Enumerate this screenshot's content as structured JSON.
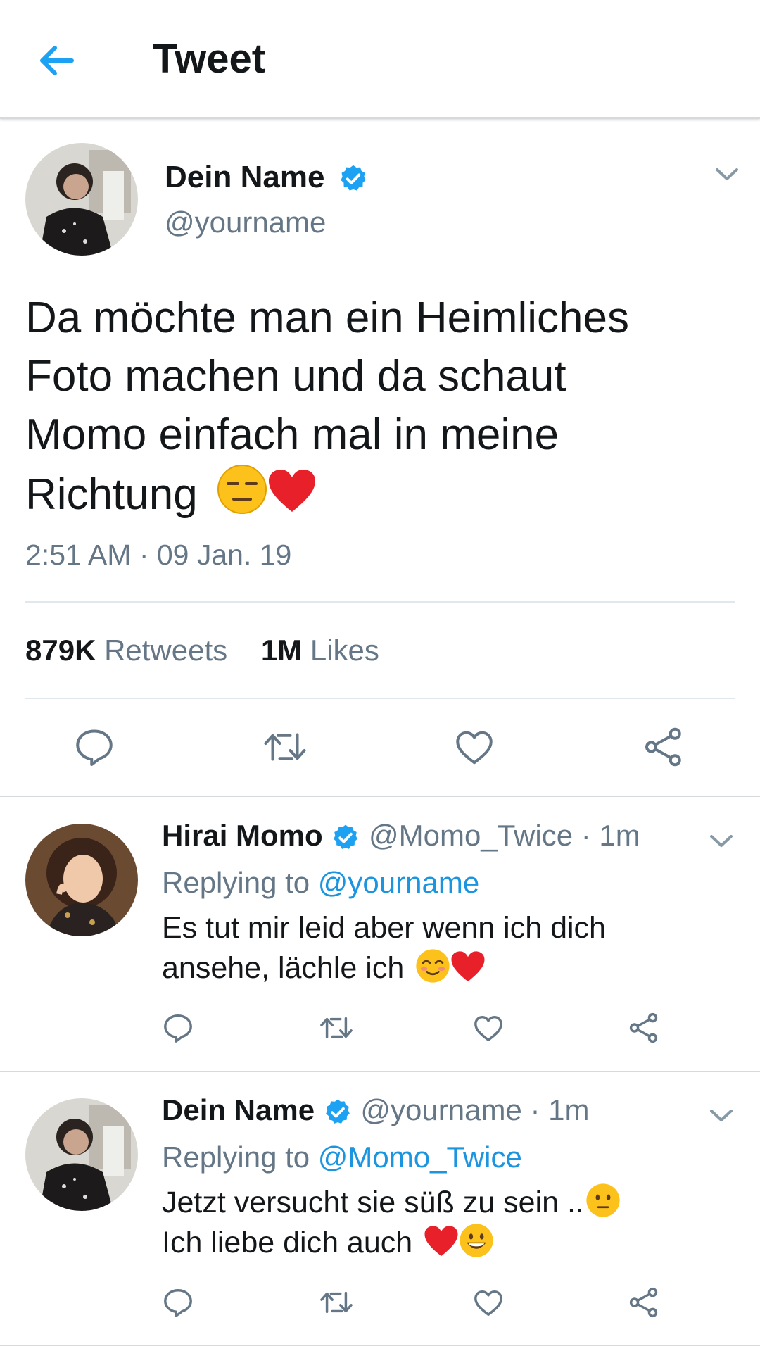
{
  "header": {
    "title": "Tweet",
    "back_icon": "arrow-left-icon",
    "accent": "#1da1f2"
  },
  "tweet": {
    "author_name": "Dein Name",
    "handle": "@yourname",
    "text_lines": [
      "Da möchte man ein Heimliches",
      "Foto machen und da schaut",
      "Momo einfach mal in meine",
      "Richtung"
    ],
    "emojis": [
      "expressionless-face",
      "red-heart"
    ],
    "timestamp": "2:51 AM · 09 Jan. 19",
    "retweets_count": "879K",
    "retweets_label": "Retweets",
    "likes_count": "1M",
    "likes_label": "Likes"
  },
  "replies": [
    {
      "author_name": "Hirai Momo",
      "handle": "@Momo_Twice",
      "time": "· 1m",
      "replying_prefix": "Replying to",
      "replying_to": "@yourname",
      "line1": "Es tut mir leid aber wenn ich dich",
      "line2": "ansehe, lächle ich",
      "emojis": [
        "smiling-face",
        "red-heart"
      ]
    },
    {
      "author_name": "Dein Name",
      "handle": "@yourname",
      "time": "· 1m",
      "replying_prefix": "Replying to",
      "replying_to": "@Momo_Twice",
      "line1": "Jetzt versucht sie süß zu sein ..",
      "line2": "Ich liebe dich auch",
      "emojis": [
        "neutral-face",
        "red-heart",
        "grinning-face"
      ]
    }
  ],
  "colors": {
    "verified": "#1da1f2",
    "link": "#1b95e0",
    "muted": "#657786",
    "icon": "#657786"
  }
}
